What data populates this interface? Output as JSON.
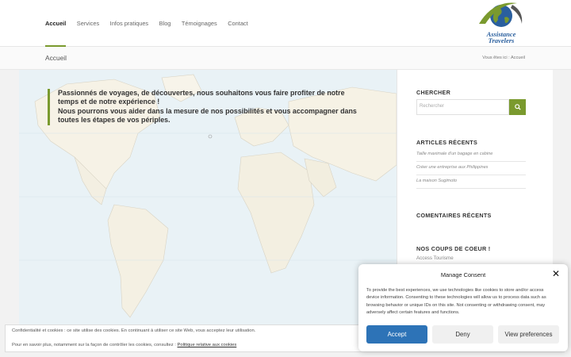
{
  "nav": {
    "items": [
      {
        "label": "Accueil",
        "active": true
      },
      {
        "label": "Services"
      },
      {
        "label": "Infos pratiques"
      },
      {
        "label": "Blog"
      },
      {
        "label": "Témoignages"
      },
      {
        "label": "Contact"
      }
    ]
  },
  "logo": {
    "line1": "Assistance",
    "line2": "Travelers"
  },
  "titlebar": {
    "title": "Accueil",
    "breadcrumb_prefix": "Vous êtes ici :",
    "breadcrumb_current": "Accueil"
  },
  "intro": {
    "p1": "Passionnés de voyages, de découvertes, nous souhaitons vous faire profiter de notre temps et de notre expérience !",
    "p2": "Nous pourrons vous aider dans la mesure de nos possibilités et vous accompagner dans toutes les étapes de vos périples."
  },
  "sidebar": {
    "search_heading": "CHERCHER",
    "search_placeholder": "Rechercher",
    "articles_heading": "ARTICLES RÉCENTS",
    "articles": [
      "Taille maximale d'un bagage en cabine",
      "Créer une entreprise aux Philippines",
      "La maison Sugimoto"
    ],
    "comments_heading": "COMENTAIRES RÉCENTS",
    "favorites_heading": "NOS COUPS DE COEUR !",
    "favorites": [
      "Access Tourisme"
    ]
  },
  "cookie_bar": {
    "line1": "Confidentialité et cookies : ce site utilise des cookies. En continuant à utiliser ce site Web, vous acceptez leur utilisation.",
    "line2_prefix": "Pour en savoir plus, notamment sur la façon de contrôler les cookies, consultez :",
    "line2_link": "Politique relative aux cookies"
  },
  "consent": {
    "title": "Manage Consent",
    "text": "To provide the best experiences, we use technologies like cookies to store and/or access device information. Consenting to these technologies will allow us to process data such as browsing behavior or unique IDs on this site. Not consenting or withdrawing consent, may adversely affect certain features and functions.",
    "accept": "Accept",
    "deny": "Deny",
    "preferences": "View preferences"
  },
  "colors": {
    "accent": "#7a9a2e",
    "button_blue": "#2d73b7",
    "logo_blue": "#2a5f9e"
  }
}
